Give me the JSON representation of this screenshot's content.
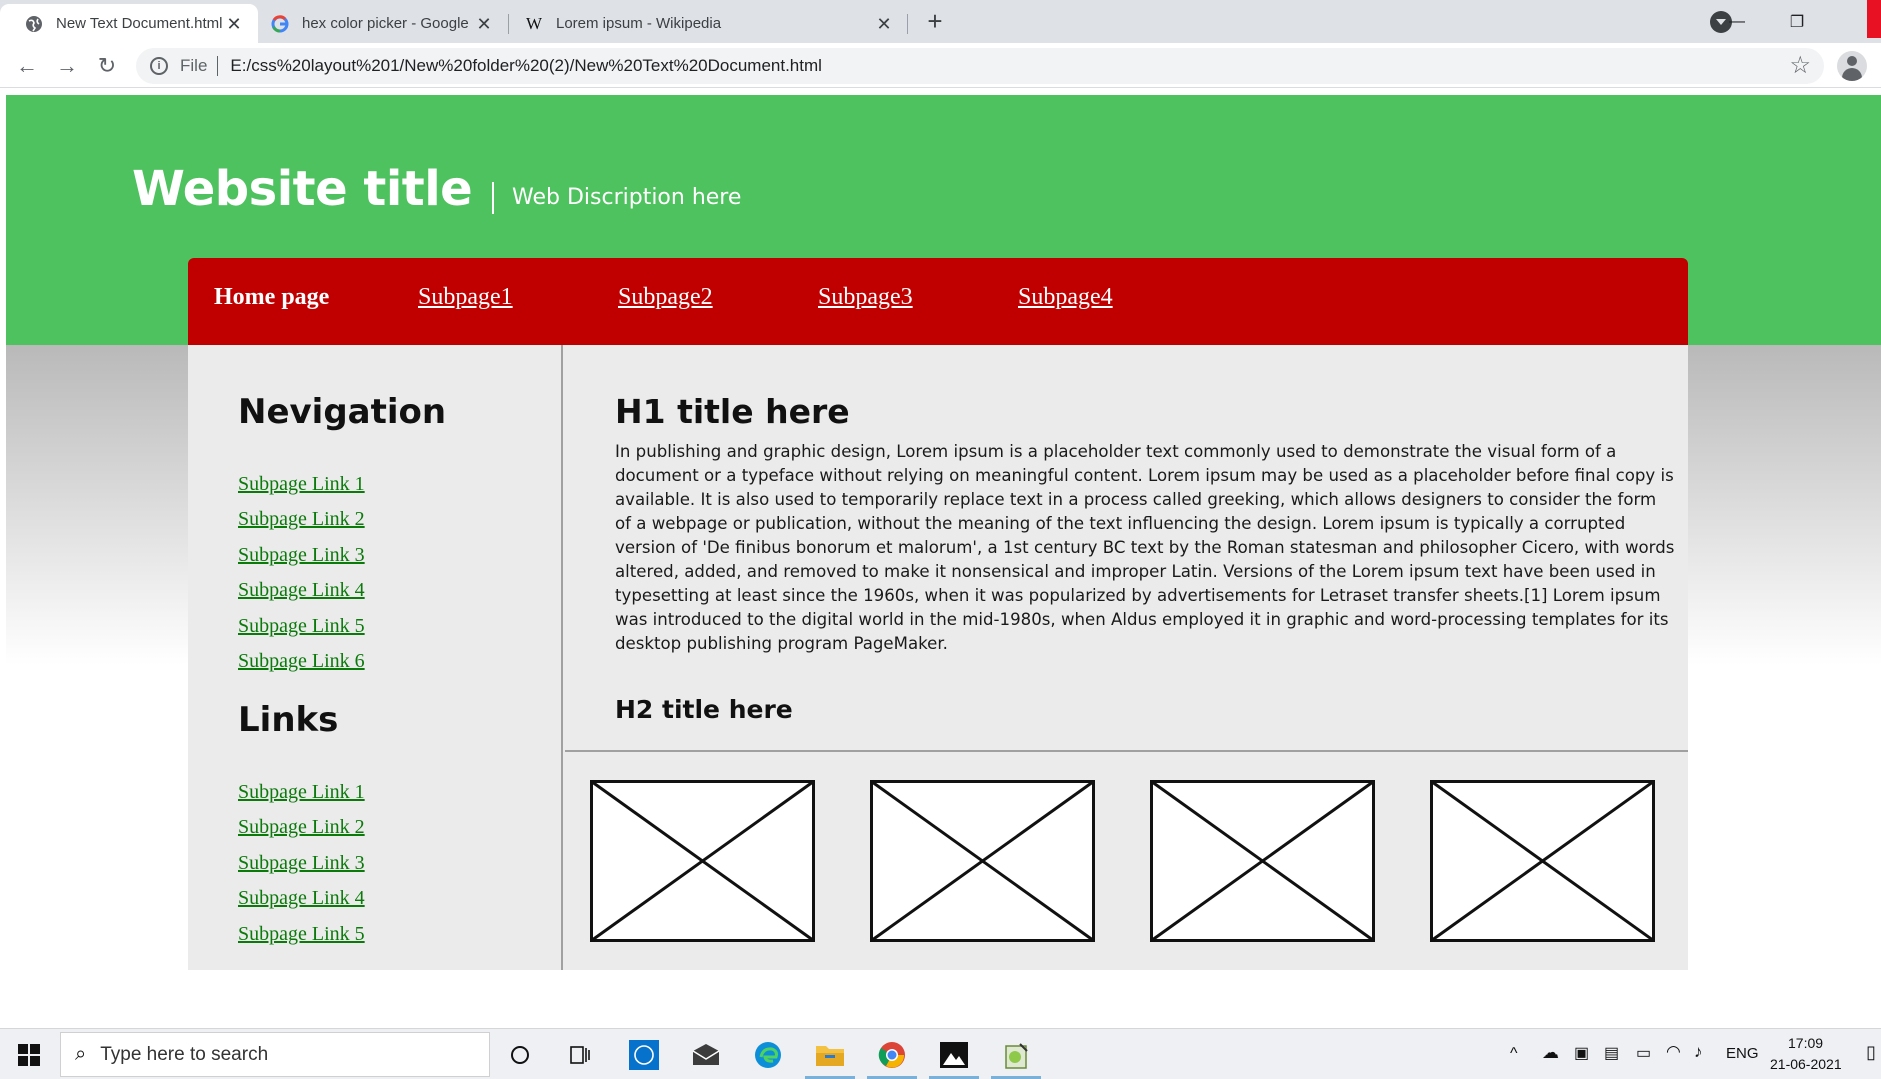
{
  "browser": {
    "tabs": [
      {
        "title": "New Text Document.html",
        "active": true
      },
      {
        "title": "hex color picker - Google Search",
        "active": false
      },
      {
        "title": "Lorem ipsum - Wikipedia",
        "active": false
      }
    ],
    "address_scheme": "File",
    "address_url": "E:/css%20layout%201/New%20folder%20(2)/New%20Text%20Document.html"
  },
  "site": {
    "title": "Website title",
    "description": "Web Discription here",
    "colors": {
      "header": "#4fc260",
      "nav": "#c00000",
      "link": "#0b7a0b"
    },
    "nav": [
      {
        "label": "Home page"
      },
      {
        "label": "Subpage1"
      },
      {
        "label": "Subpage2"
      },
      {
        "label": "Subpage3"
      },
      {
        "label": "Subpage4"
      }
    ]
  },
  "sidebar": {
    "heading1": "Nevigation",
    "links1": [
      "Subpage Link 1",
      "Subpage Link 2",
      "Subpage Link 3",
      "Subpage Link 4",
      "Subpage Link 5",
      "Subpage Link 6"
    ],
    "heading2": "Links",
    "links2": [
      "Subpage Link 1",
      "Subpage Link 2",
      "Subpage Link 3",
      "Subpage Link 4",
      "Subpage Link 5"
    ]
  },
  "main": {
    "h1": "H1 title here",
    "paragraph": "In publishing and graphic design, Lorem ipsum is a placeholder text commonly used to demonstrate the visual form of a document or a typeface without relying on meaningful content. Lorem ipsum may be used as a placeholder before final copy is available. It is also used to temporarily replace text in a process called greeking, which allows designers to consider the form of a webpage or publication, without the meaning of the text influencing the design. Lorem ipsum is typically a corrupted version of 'De finibus bonorum et malorum', a 1st century BC text by the Roman statesman and philosopher Cicero, with words altered, added, and removed to make it nonsensical and improper Latin. Versions of the Lorem ipsum text have been used in typesetting at least since the 1960s, when it was popularized by advertisements for Letraset transfer sheets.[1] Lorem ipsum was introduced to the digital world in the mid-1980s, when Aldus employed it in graphic and word-processing templates for its desktop publishing program PageMaker.",
    "h2": "H2 title here",
    "image_placeholders": 4
  },
  "taskbar": {
    "search_placeholder": "Type here to search",
    "language": "ENG",
    "time": "17:09",
    "date": "21-06-2021"
  }
}
